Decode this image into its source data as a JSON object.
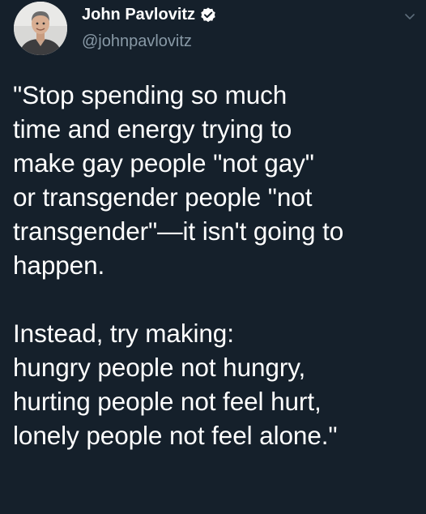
{
  "author": {
    "display_name": "John Pavlovitz",
    "handle": "@johnpavlovitz",
    "verified": true
  },
  "tweet": {
    "paragraph1": [
      "\"Stop spending so much",
      "time and energy trying to",
      "make gay people \"not gay\"",
      "or transgender people \"not",
      "transgender\"—it isn't going to",
      "happen."
    ],
    "paragraph2": [
      "Instead, try making:",
      "hungry people not hungry,",
      "hurting people not feel hurt,",
      "lonely people not feel alone.\""
    ]
  },
  "colors": {
    "background": "#15202b",
    "text": "#ffffff",
    "secondary_text": "#8899a6",
    "verified_badge": "#ffffff"
  },
  "icons": {
    "avatar": "profile-photo",
    "verified": "verified-badge-icon",
    "menu": "chevron-down-icon"
  }
}
